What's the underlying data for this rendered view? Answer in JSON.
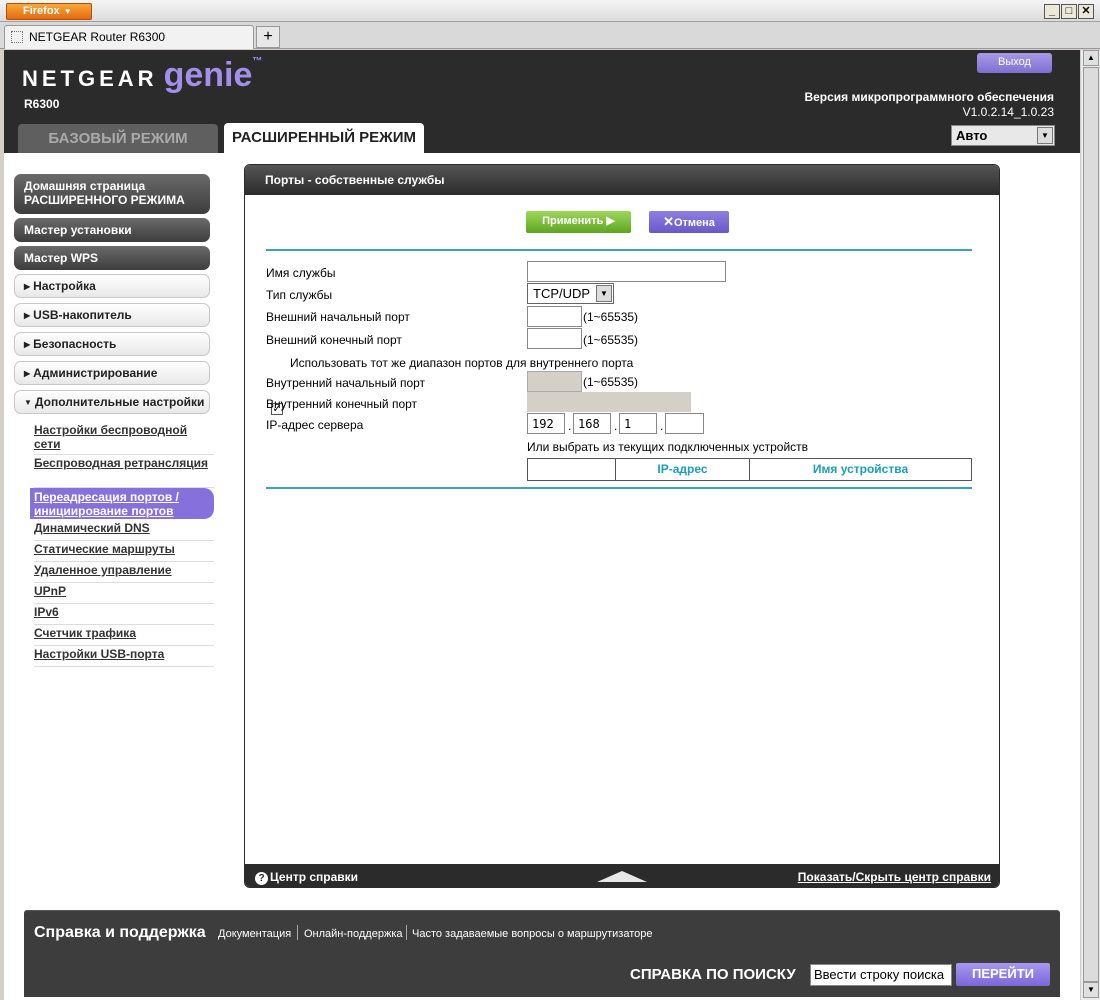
{
  "browser": {
    "menu_button": "Firefox",
    "tab_title": "NETGEAR Router R6300",
    "new_tab": "+",
    "window_controls": [
      "_",
      "□",
      "✕"
    ]
  },
  "header": {
    "brand": "NETGEAR",
    "product": "genie",
    "trademark": "™",
    "model": "R6300",
    "logout_label": "Выход",
    "firmware_label": "Версия микропрограммного обеспечения",
    "firmware_version": "V1.0.2.14_1.0.23",
    "language_selected": "Авто",
    "tab_basic": "БАЗОВЫЙ РЕЖИМ",
    "tab_advanced": "РАСШИРЕННЫЙ РЕЖИМ"
  },
  "sidebar": {
    "home_line1": "Домашняя страница",
    "home_line2": "РАСШИРЕННОГО РЕЖИМА",
    "setup_wizard": "Мастер установки",
    "wps_wizard": "Мастер WPS",
    "sections": [
      "Настройка",
      "USB-накопитель",
      "Безопасность",
      "Администрирование",
      "Дополнительные настройки"
    ],
    "submenu": [
      "Настройки беспроводной сети",
      "Беспроводная ретрансляция",
      "Переадресация портов / инициирование портов",
      "Динамический DNS",
      "Статические маршруты",
      "Удаленное управление",
      "UPnP",
      "IPv6",
      "Счетчик трафика",
      "Настройки USB-порта"
    ]
  },
  "panel": {
    "title": "Порты - собственные службы",
    "apply_label": "Применить ▶",
    "cancel_label": "Отмена",
    "service_name_label": "Имя службы",
    "service_name_value": "",
    "service_type_label": "Тип службы",
    "service_type_value": "TCP/UDP",
    "ext_start_label": "Внешний начальный порт",
    "ext_end_label": "Внешний конечный порт",
    "range_hint": "(1~65535)",
    "same_range_checked": true,
    "same_range_label": "Использовать тот же диапазон портов для внутреннего порта",
    "int_start_label": "Внутренний начальный порт",
    "int_end_label": "Внутренний конечный порт",
    "server_ip_label": "IP-адрес сервера",
    "ip_octets": [
      "192",
      "168",
      "1",
      ""
    ],
    "choose_device_label": "Или выбрать из текущих подключенных устройств",
    "table_headers": [
      "",
      "IP-адрес",
      "Имя устройства"
    ],
    "help_center": "Центр справки",
    "help_toggle": "Показать/Скрыть центр справки"
  },
  "footer": {
    "title": "Справка и поддержка",
    "links": [
      "Документация",
      "Онлайн-поддержка",
      "Часто задаваемые вопросы о маршрутизаторе"
    ],
    "search_title": "СПРАВКА ПО ПОИСКУ",
    "search_placeholder": "Ввести строку поиска",
    "search_button": "ПЕРЕЙТИ"
  },
  "colors": {
    "accent_purple": "#8570dc",
    "apply_green": "#6fb62e",
    "divider_teal": "#3aa5b8",
    "header_dark": "#2b2b2b"
  }
}
